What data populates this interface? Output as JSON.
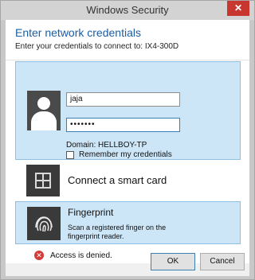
{
  "window": {
    "title": "Windows Security",
    "close_glyph": "✕"
  },
  "header": {
    "title": "Enter network credentials",
    "subtitle": "Enter your credentials to connect to: IX4-300D"
  },
  "credential": {
    "username": "jaja",
    "password_mask": "•••••••",
    "domain": "Domain: HELLBOY-TP",
    "remember_label": "Remember my credentials"
  },
  "smart_card": {
    "label": "Connect a smart card"
  },
  "fingerprint": {
    "title": "Fingerprint",
    "description": "Scan a registered finger on the fingerprint reader."
  },
  "error": {
    "text": "Access is denied."
  },
  "buttons": {
    "ok": "OK",
    "cancel": "Cancel"
  },
  "colors": {
    "accent": "#1a5ea5",
    "tile_selected": "#cde6f7",
    "close": "#c7372f",
    "error": "#d33b3b"
  }
}
